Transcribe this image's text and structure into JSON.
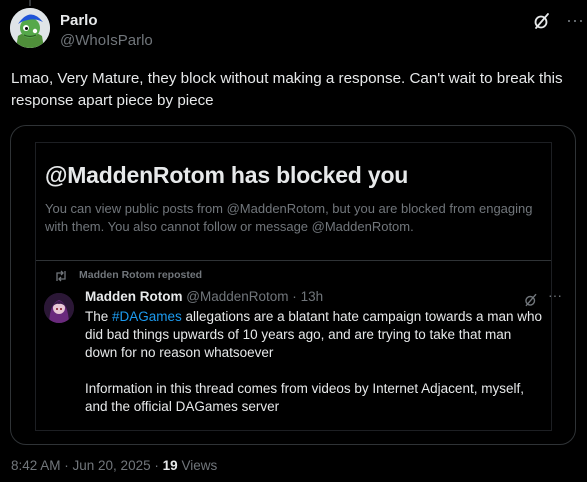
{
  "tweet": {
    "author_name": "Parlo",
    "author_handle": "@WhoIsParlo",
    "text": "Lmao, Very Mature, they block without making a response. Can't wait to break this response apart piece by piece",
    "timestamp": "8:42 AM · Jun 20, 2025",
    "separator": "·",
    "views_count": "19",
    "views_label": "Views"
  },
  "embedded_screenshot": {
    "blocked_title": "@MaddenRotom has blocked you",
    "blocked_description": "You can view public posts from @MaddenRotom, but you are blocked from engaging with them. You also cannot follow or message @MaddenRotom.",
    "repost_label": "Madden Rotom reposted",
    "inner_post": {
      "author_name": "Madden Rotom",
      "author_handle": "@MaddenRotom",
      "meta_separator": "·",
      "time_ago": "13h",
      "text_before_tag": "The ",
      "hashtag": "#DAGames",
      "text_after_tag": " allegations are a blatant hate campaign towards a man who did bad things upwards of 10 years ago, and are trying to take that man down for no reason whatsoever",
      "paragraph_2": "Information in this thread comes from videos by Internet Adjacent, myself, and the official DAGames server"
    }
  },
  "icons": {
    "grok": "grok-icon",
    "more": "more-options-icon",
    "repost": "repost-icon"
  },
  "colors": {
    "background": "#000000",
    "primary_text": "#e7e9ea",
    "secondary_text": "#71767b",
    "border": "#2f3336",
    "link": "#1d9bf0"
  }
}
